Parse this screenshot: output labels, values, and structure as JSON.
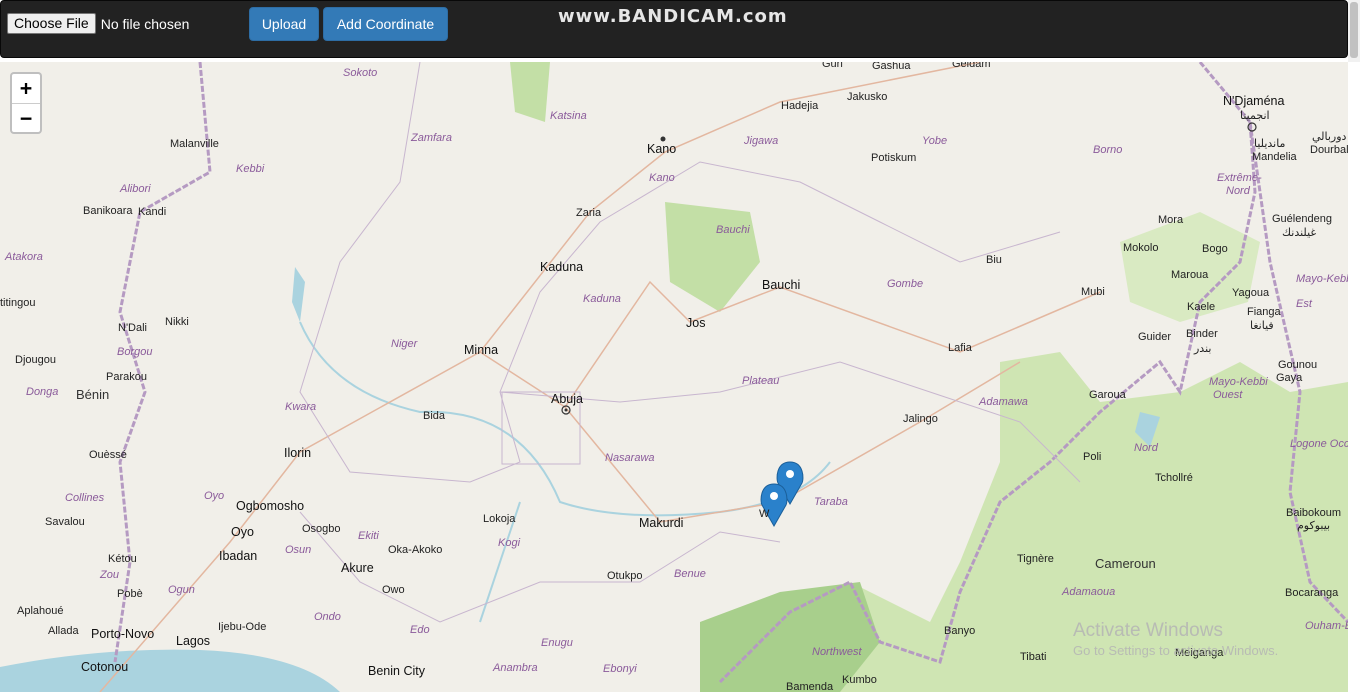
{
  "toolbar": {
    "choose_file_label": "Choose File",
    "file_status": "No file chosen",
    "upload_label": "Upload",
    "add_coordinate_label": "Add Coordinate",
    "watermark": "www.BANDICAM.com",
    "accent_color": "#337ab7"
  },
  "map": {
    "zoom_in": "+",
    "zoom_out": "−",
    "labels": {
      "gurl": "Gurl",
      "gashua": "Gashua",
      "geidam": "Geidam",
      "sokoto": "Sokoto",
      "hadejia": "Hadejia",
      "jakusko": "Jakusko",
      "ndjamena": "N'Djaména",
      "ndjamena_ar": "انجمينا",
      "katsina": "Katsina",
      "zamfara": "Zamfara",
      "kano": "Kano",
      "jigawa": "Jigawa",
      "yobe": "Yobe",
      "borno": "Borno",
      "malanville": "Malanville",
      "kebbi": "Kebbi",
      "potiskum": "Potiskum",
      "dourbali": "Dourbali",
      "dourbali_ar": "دوربالي",
      "mandelia": "Mandelia",
      "mandelia_ar": "مانديليا",
      "kano_state": "Kano",
      "extreme_nord": "Extrême-",
      "extreme_nord2": "Nord",
      "alibori": "Alibori",
      "banikoara": "Banikoara",
      "kandi": "Kandi",
      "zaria": "Zaria",
      "bauchi_state": "Bauchi",
      "mora": "Mora",
      "guelendeng": "Guélendeng",
      "guelendeng_ar": "غيلندنك",
      "kokolo": "Mokolo",
      "bogo": "Bogo",
      "atakora": "Atakora",
      "kaduna": "Kaduna",
      "biu": "Biu",
      "maroua": "Maroua",
      "mayo_kebbi_est": "Mayo-Kebbi",
      "mayo_kebbi_est2": "Est",
      "bauchi": "Bauchi",
      "gombe": "Gombe",
      "kaduna_state": "Kaduna",
      "mubi": "Mubi",
      "yagoua": "Yagoua",
      "kaele": "Kaele",
      "fianga": "Fianga",
      "fianga_ar": "فيانغا",
      "ndali": "N'Dali",
      "nikki": "Nikki",
      "jos": "Jos",
      "niger": "Niger",
      "guider": "Guider",
      "binder": "Binder",
      "binder_ar": "بندر",
      "djougou": "Djougou",
      "borgou": "Borgou",
      "minna": "Minna",
      "lafia": "Lafia",
      "gounou_gaya": "Gounou",
      "gounou_gaya2": "Gaya",
      "parakou": "Parakou",
      "plateau": "Plateau",
      "mayo_kebbi_ouest": "Mayo-Kebbi",
      "mayo_kebbi_ouest2": "Ouest",
      "donga": "Donga",
      "benin": "Bénin",
      "abuja": "Abuja",
      "adamawa": "Adamawa",
      "garoua": "Garoua",
      "kwara": "Kwara",
      "bida": "Bida",
      "jalingo": "Jalingo",
      "logone_occ": "Logone Occ",
      "ouesse": "Ouèssé",
      "ilorin": "Ilorin",
      "nasarawa": "Nasarawa",
      "nord": "Nord",
      "poli": "Poli",
      "tcholire": "Tchollré",
      "collines": "Collines",
      "oyo_state": "Oyo",
      "ogbomosho": "Ogbomosho",
      "taraba": "Taraba",
      "baibokoum": "Baibokoum",
      "baibokoum_ar": "بيبوكوم",
      "savalou": "Savalou",
      "oyo": "Oyo",
      "osogbo": "Osogbo",
      "lokoja": "Lokoja",
      "makurdi": "Makurdi",
      "wukari": "W",
      "ekiti": "Ekiti",
      "kogi": "Kogi",
      "ibadan": "Ibadan",
      "osun": "Osun",
      "oka_akoko": "Oka-Akoko",
      "ketou": "Kétou",
      "tignere": "Tignère",
      "zou": "Zou",
      "akure": "Akure",
      "otukpo": "Otukpo",
      "benue": "Benue",
      "cameroun": "Cameroun",
      "ogun": "Ogun",
      "owo": "Owo",
      "pobe": "Pobè",
      "adamaoua": "Adamaoua",
      "bocaranga": "Bocaranga",
      "aplahoue": "Aplahoué",
      "ondo": "Ondo",
      "ouham": "Ouham-E",
      "ijebu_ode": "Ijebu-Ode",
      "banyo": "Banyo",
      "allada": "Allada",
      "porto_novo": "Porto-Novo",
      "edo": "Edo",
      "lagos": "Lagos",
      "enugu": "Enugu",
      "northwest": "Northwest",
      "tibati": "Tibati",
      "meiganga": "Meiganga",
      "cotonou": "Cotonou",
      "benin_city": "Benin City",
      "anambra": "Anambra",
      "ebonyi": "Ebonyi",
      "bamenda": "Bamenda",
      "kumbo": "Kumbo",
      "titingou": "titingou",
      "ouham_prefix": "Ouham-E"
    },
    "markers": [
      "marker-1",
      "marker-2"
    ]
  },
  "system": {
    "activate_title": "Activate Windows",
    "activate_sub": "Go to Settings to activate Windows."
  }
}
